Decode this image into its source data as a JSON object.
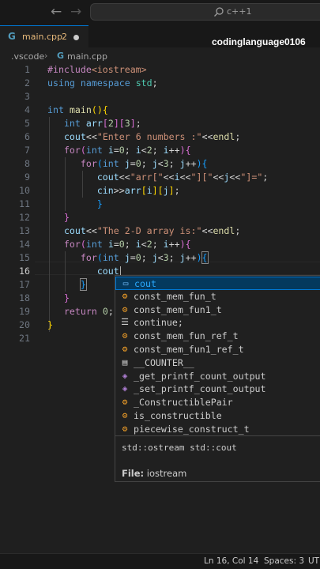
{
  "titlebar": {
    "search_placeholder": "c++1",
    "icons": [
      "back-arrow-icon",
      "forward-arrow-icon",
      "search-icon"
    ]
  },
  "tab": {
    "filename": "main.cpp",
    "problem_count": "2",
    "icon": "C"
  },
  "watermark": "codinglanguage0106",
  "breadcrumb": {
    "folder": ".vscode",
    "separator": "›",
    "file": "main.cpp"
  },
  "editor": {
    "line_numbers": [
      "1",
      "2",
      "3",
      "4",
      "5",
      "6",
      "7",
      "8",
      "9",
      "10",
      "11",
      "12",
      "13",
      "14",
      "15",
      "16",
      "17",
      "18",
      "19",
      "20",
      "21"
    ],
    "active_line": "16"
  },
  "suggest": {
    "items": [
      {
        "kind": "variable",
        "icon": "variable-icon",
        "prefix": "cout",
        "rest": ""
      },
      {
        "kind": "struct",
        "icon": "struct-icon",
        "label": "const_mem_fun_t"
      },
      {
        "kind": "struct",
        "icon": "struct-icon",
        "label": "const_mem_fun1_t"
      },
      {
        "kind": "keyword",
        "icon": "keyword-icon",
        "label": "continue;"
      },
      {
        "kind": "struct",
        "icon": "struct-icon",
        "label": "const_mem_fun_ref_t"
      },
      {
        "kind": "struct",
        "icon": "struct-icon",
        "label": "const_mem_fun1_ref_t"
      },
      {
        "kind": "constant",
        "icon": "macro-icon",
        "label": "__COUNTER__"
      },
      {
        "kind": "function",
        "icon": "function-icon",
        "label": "_get_printf_count_output"
      },
      {
        "kind": "function",
        "icon": "function-icon",
        "label": "_set_printf_count_output"
      },
      {
        "kind": "struct",
        "icon": "struct-icon",
        "label": "_ConstructiblePair"
      },
      {
        "kind": "struct",
        "icon": "struct-field-icon",
        "label": "is_constructible"
      },
      {
        "kind": "struct",
        "icon": "struct-field-icon",
        "label": "piecewise_construct_t"
      }
    ],
    "signature": "std::ostream std::cout",
    "file_label": "File:",
    "file_value": "iostream"
  },
  "statusbar": {
    "position": "Ln 16, Col 14",
    "spaces": "Spaces: 3",
    "encoding": "UT"
  }
}
